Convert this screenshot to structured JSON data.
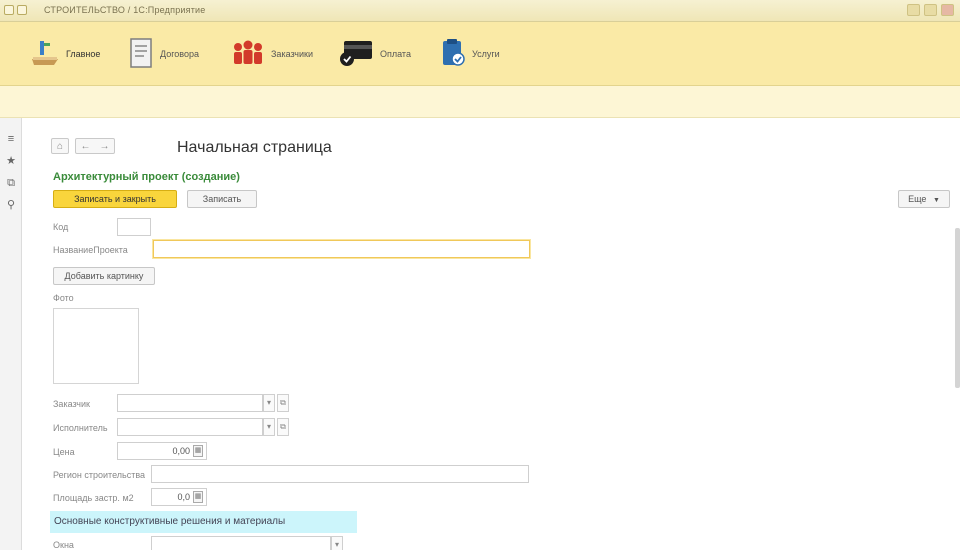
{
  "window": {
    "title": "СТРОИТЕЛЬСТВО / 1С:Предприятие"
  },
  "sections": [
    {
      "label": "Главное",
      "icon": "home-desk-icon"
    },
    {
      "label": "Договора",
      "icon": "document-icon"
    },
    {
      "label": "Заказчики",
      "icon": "people-icon"
    },
    {
      "label": "Оплата",
      "icon": "payment-card-icon"
    },
    {
      "label": "Услуги",
      "icon": "clipboard-check-icon"
    }
  ],
  "nav": {
    "home": "⌂",
    "back": "←",
    "forward": "→",
    "page_title": "Начальная страница"
  },
  "form": {
    "title": "Архитектурный проект (создание)",
    "save_close": "Записать и закрыть",
    "save": "Записать",
    "more": "Еще",
    "labels": {
      "code": "Код",
      "project_name": "НазваниеПроекта",
      "add_picture": "Добавить картинку",
      "photo": "Фото",
      "customer": "Заказчик",
      "executor": "Исполнитель",
      "price": "Цена",
      "region": "Регион строительства",
      "area": "Площадь застр. м2",
      "group": "Основные конструктивные решения и материалы",
      "walls": "Окна"
    },
    "values": {
      "code": "",
      "project_name": "",
      "customer": "",
      "executor": "",
      "price": "0,00",
      "region": "",
      "area": "0,0",
      "walls": ""
    }
  }
}
